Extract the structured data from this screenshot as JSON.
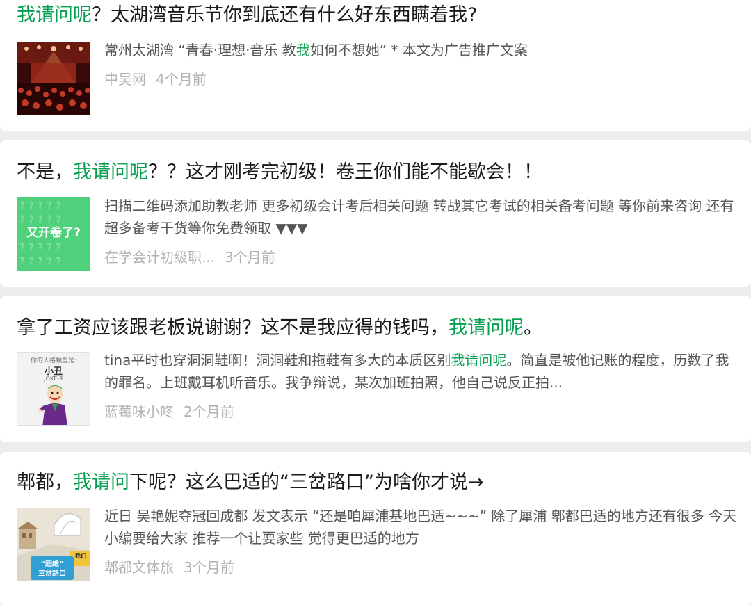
{
  "colors": {
    "highlight": "#07a050",
    "background": "#ededed",
    "card": "#ffffff"
  },
  "articles": [
    {
      "title": {
        "pre": "",
        "hl": "我请问呢",
        "post": "？太湖湾音乐节你到底还有什么好东西瞒着我?"
      },
      "desc": {
        "pre": "常州太湖湾 “青春·理想·音乐 教",
        "hl": "我",
        "post": "如何不想她” * 本文为广告推广文案"
      },
      "source": "中吴网",
      "time": "4个月前",
      "thumb_icon": "concert-photo"
    },
    {
      "title": {
        "pre": "不是，",
        "hl": "我请问呢",
        "post": "？？这才刚考完初级！卷王你们能不能歇会！！"
      },
      "desc": {
        "pre": "扫描二维码添加助教老师 更多初级会计考后相关问题 转战其它考试的相关备考问题 等你前来咨询 还有超多备考干货等你免费领取 ▼▼▼",
        "hl": "",
        "post": ""
      },
      "source": "在学会计初级职...",
      "time": "3个月前",
      "thumb_icon": "question-marks-banner",
      "thumb_text": "又开卷了?"
    },
    {
      "title": {
        "pre": "拿了工资应该跟老板说谢谢？这不是我应得的钱吗，",
        "hl": "我请问呢",
        "post": "。"
      },
      "desc": {
        "pre": "tina平时也穿洞洞鞋啊！洞洞鞋和拖鞋有多大的本质区别",
        "hl": "我请问呢",
        "post": "。简直是被他记账的程度，历数了我的罪名。上班戴耳机听音乐。我争辩说，某次加班拍照，他自己说反正拍..."
      },
      "source": "蓝莓味小咚",
      "time": "2个月前",
      "thumb_icon": "joker-cartoon",
      "thumb_caption": "你的人格類型是:",
      "thumb_name": "小丑",
      "thumb_sub": "JOKE-R"
    },
    {
      "title": {
        "pre": "郫都，",
        "hl": "我请问",
        "post": "下呢？这么巴适的“三岔路口”为啥你才说→"
      },
      "desc": {
        "pre": "近日 吴艳妮夺冠回成都 发文表示 “还是咱犀浦基地巴适~~~” 除了犀浦 郫都巴适的地方还有很多 今天 小编要给大家 推荐一个让耍家些 觉得更巴适的地方",
        "hl": "",
        "post": ""
      },
      "source": "郫都文体旅",
      "time": "3个月前",
      "thumb_icon": "map-illustration",
      "thumb_label1": "“超绝”",
      "thumb_label2": "三岔路口",
      "thumb_label3": "我们"
    }
  ]
}
